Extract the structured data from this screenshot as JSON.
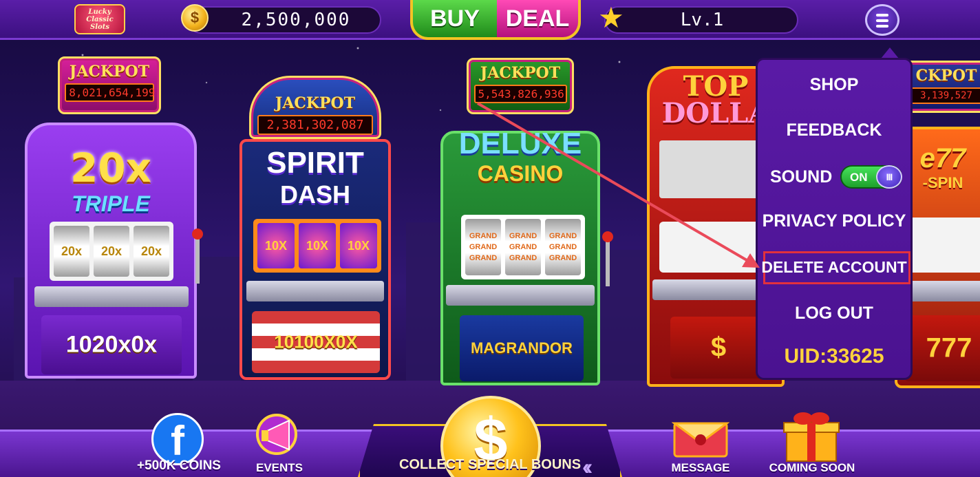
{
  "header": {
    "logo_text": "Lucky Classic Slots",
    "coins": "2,500,000",
    "buy_label": "BUY",
    "deal_label": "DEAL",
    "level": "Lv.1"
  },
  "machines": [
    {
      "jackpot_label": "JACKPOT",
      "jackpot_amount": "8,021,654,199",
      "title_line1": "20x",
      "title_line2": "TRIPLE",
      "reel_symbol": "20x",
      "base_emblem": "1020x0x"
    },
    {
      "jackpot_label": "JACKPOT",
      "jackpot_amount": "2,381,302,087",
      "title_line1": "SPIRIT",
      "title_line2": "DASH",
      "reel_symbol": "10X",
      "base_emblem": "10100X0X"
    },
    {
      "jackpot_label": "JACKPOT",
      "jackpot_amount": "5,543,826,936",
      "title_line1": "DELUXE",
      "title_line2": "CASINO",
      "reel_symbol": "GRAND",
      "base_emblem": "MAGRANDOR"
    },
    {
      "title_line1": "TOP",
      "title_line2": "DOLLA"
    },
    {
      "jackpot_label": "CKPOT",
      "jackpot_amount": "3,139,527",
      "title_line1": "e77",
      "title_line2": "-SPIN"
    }
  ],
  "menu": {
    "shop": "SHOP",
    "feedback": "FEEDBACK",
    "sound_label": "SOUND",
    "sound_toggle": "ON",
    "privacy_policy": "PRIVACY POLICY",
    "delete_account": "DELETE ACCOUNT",
    "log_out": "LOG OUT",
    "uid": "UID:33625"
  },
  "bottom": {
    "facebook_label": "+500K COINS",
    "events_label": "EVENTS",
    "collect_label": "COLLECT SPECIAL BOUNS",
    "message_label": "MESSAGE",
    "coming_soon_label": "COMING SOON"
  },
  "colors": {
    "menu_bg": "#5a1aa6",
    "highlight_box": "#e2313d",
    "uid_gold": "#ffd23c",
    "buy_green": "#1f8a1a",
    "deal_pink": "#b4117c"
  }
}
